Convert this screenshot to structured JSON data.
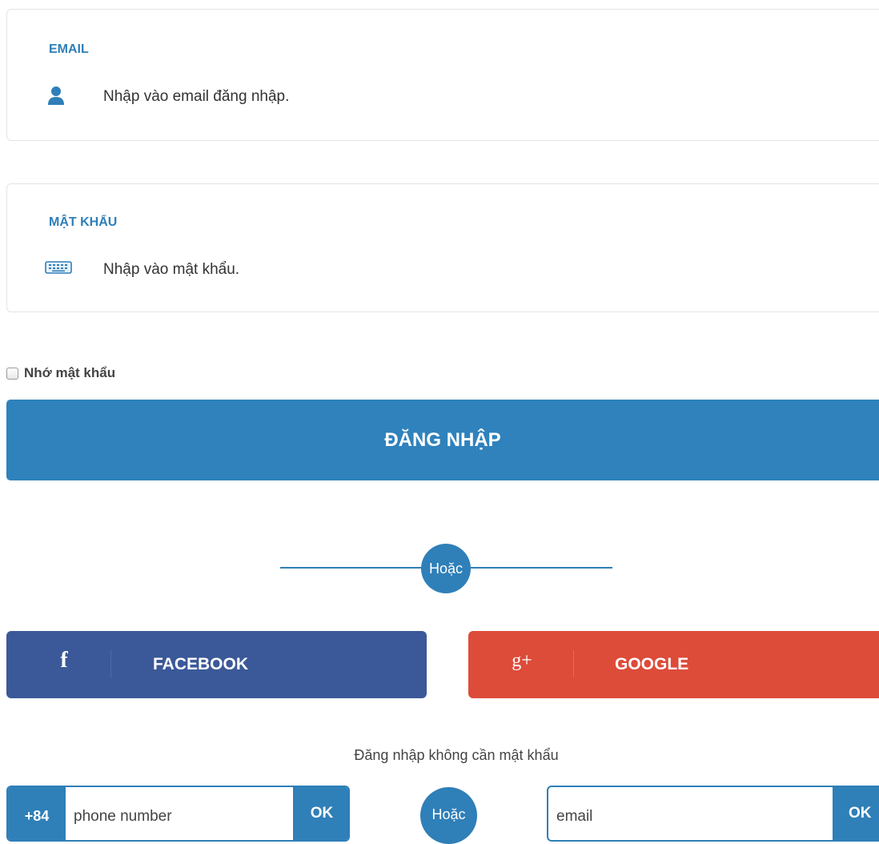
{
  "email_field": {
    "label": "EMAIL",
    "placeholder": "Nhập vào email đăng nhập.",
    "icon": "user-icon"
  },
  "password_field": {
    "label": "MẬT KHẨU",
    "placeholder": "Nhập vào mật khẩu.",
    "icon": "keyboard-icon"
  },
  "remember": {
    "label": "Nhớ mật khẩu",
    "checked": false
  },
  "login_button": {
    "label": "ĐĂNG NHẬP"
  },
  "divider": {
    "label": "Hoặc"
  },
  "social": {
    "facebook": {
      "label": "FACEBOOK",
      "icon": "facebook-icon",
      "color": "#3b5998"
    },
    "google": {
      "label": "GOOGLE",
      "icon": "google-plus-icon",
      "color": "#dd4b39"
    }
  },
  "passwordless": {
    "title": "Đăng nhập không cần mật khẩu",
    "phone_prefix": "+84",
    "phone_placeholder": "phone number",
    "ok_label": "OK",
    "or_label": "Hoặc",
    "email_placeholder": "email"
  },
  "colors": {
    "primary": "#2f82bc",
    "facebook": "#3b5998",
    "google": "#dd4b39"
  }
}
